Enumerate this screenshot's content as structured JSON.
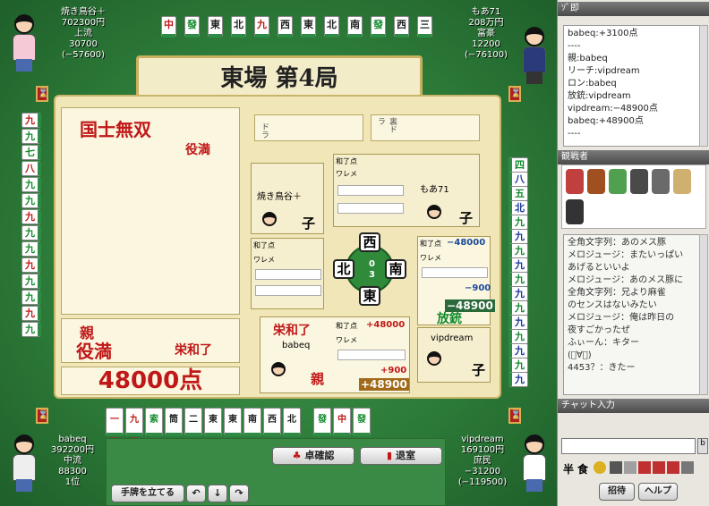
{
  "round": "東場  第4局",
  "dora_label": "ドラ",
  "uradora_label": "裏ドラ",
  "win": {
    "yaku_name": "国士無双",
    "limit": "役満",
    "dealer_label": "親",
    "dealer_limit": "役満",
    "win_type": "栄和了",
    "points": "48000点"
  },
  "top_wall": [
    "中",
    "發",
    "東",
    "北",
    "九",
    "西",
    "東",
    "北",
    "南",
    "發",
    "西",
    "三"
  ],
  "left_wall": [
    "九",
    "九",
    "七",
    "八",
    "九",
    "九",
    "九",
    "九",
    "九",
    "九",
    "九",
    "九",
    "九",
    "九"
  ],
  "right_wall": [
    "四",
    "八",
    "五",
    "北",
    "九",
    "九",
    "九",
    "九",
    "九",
    "九",
    "九",
    "九",
    "九",
    "九",
    "九",
    "九"
  ],
  "hand": [
    "一萬",
    "九萬",
    "索",
    "筒",
    "二",
    "東",
    "東",
    "南",
    "西",
    "北",
    "",
    "發",
    "中",
    "發"
  ],
  "players": {
    "top_left": {
      "name": "焼き鳥谷＋",
      "money": "702300円",
      "rank": "上流",
      "score": "30700",
      "diff": "(−57600)"
    },
    "top_right": {
      "name": "もあ71",
      "money": "208万円",
      "rank": "富豪",
      "score": "12200",
      "diff": "(−76100)"
    },
    "bottom_left": {
      "name": "babeq",
      "money": "392200円",
      "rank": "中流",
      "score": "88300",
      "place": "1位"
    },
    "bottom_right": {
      "name": "vipdream",
      "money": "169100円",
      "rank": "庶民",
      "score": "−31200",
      "diff": "(−119500)"
    }
  },
  "score_boxes": {
    "yakitori": {
      "name": "焼き鳥谷＋",
      "role": "子",
      "header": "和了点",
      "sub": "ワレメ"
    },
    "moa": {
      "name": "もあ71",
      "role": "子",
      "header": "和了点",
      "sub": "ワレメ"
    },
    "vip": {
      "name": "vipdream",
      "role": "子",
      "header": "和了点",
      "delta": "−48000",
      "sub": "ワレメ",
      "extra": "−900",
      "total": "−48900",
      "label": "放銃"
    },
    "babeq": {
      "name": "babeq",
      "role": "親",
      "header": "和了点",
      "delta": "+48000",
      "sub": "ワレメ",
      "extra": "+900",
      "total": "+48900",
      "label": "栄和了"
    }
  },
  "compass": {
    "north": "西",
    "west": "北",
    "east": "南",
    "south": "東",
    "center_top": "0",
    "center_bottom": "3"
  },
  "buttons": {
    "table_check": "卓確認",
    "leave": "退室",
    "hand_stand": "手牌を立てる",
    "invite": "招待",
    "help": "ヘルプ"
  },
  "sidebar": {
    "title": "ｿﾞ即",
    "log": [
      "babeq:+3100点",
      "----",
      "親:babeq",
      "リーチ:vipdream",
      "ロン:babeq",
      "放銃:vipdream",
      "vipdream:−48900点",
      "babeq:+48900点",
      "----"
    ],
    "spectators_label": "観戦者",
    "chat": [
      "全角文字列：あのメス豚",
      "メロジュージ：またいっぱい",
      "あげるといいよ",
      "メロジュージ：あのメス豚に",
      "全角文字列：兄より麻雀",
      "のセンスはないみたい",
      "メロジュージ：俺は昨日の",
      "夜すごかったぜ",
      "ふぃーん：キター",
      "(ﾟ∀ﾟ)",
      "4453？：きたー"
    ],
    "chat_input_label": "チャット入力",
    "toolbar_icons": [
      "半",
      "食"
    ]
  }
}
